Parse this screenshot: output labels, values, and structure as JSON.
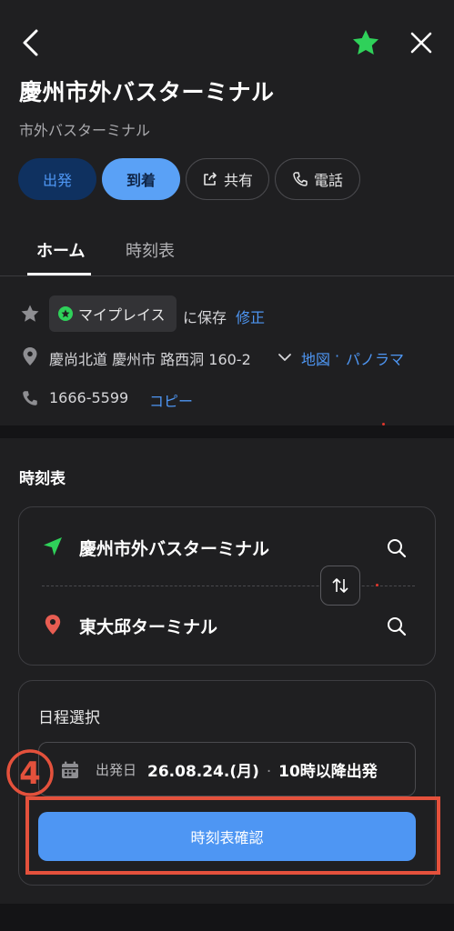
{
  "header": {
    "title": "慶州市外バスターミナル",
    "subtitle": "市外バスターミナル"
  },
  "actions": {
    "depart": "出発",
    "arrive": "到着",
    "share": "共有",
    "phone": "電話"
  },
  "tabs": {
    "home": "ホーム",
    "timetable": "時刻表"
  },
  "info": {
    "myplace_chip": "マイプレイス",
    "saved_text": "に保存",
    "edit_link": "修正",
    "address": "慶尚北道 慶州市 路西洞 160-2",
    "map_link": "地図",
    "link_separator": "·",
    "panorama_link": "パノラマ",
    "phone_number": "1666-5599",
    "copy_link": "コピー"
  },
  "timetable_section": {
    "title": "時刻表",
    "origin": "慶州市外バスターミナル",
    "destination": "東大邱ターミナル"
  },
  "schedule": {
    "title": "日程選択",
    "date_label": "出発日",
    "date_value": "26.08.24.(月)",
    "separator": "·",
    "time_value": "10時以降出発",
    "step_number": "4",
    "confirm_button": "時刻表確認"
  },
  "colors": {
    "background": "#1f1f21",
    "accent_blue": "#4e96f3",
    "favorite_green": "#2fd15a",
    "highlight_red": "#e4513c",
    "destination_pin": "#e85d52"
  },
  "icons": [
    "back-icon",
    "star-icon",
    "close-icon",
    "share-icon",
    "phone-icon",
    "location-pin-icon",
    "chevron-down-icon",
    "navigation-arrow-icon",
    "swap-icon",
    "search-icon",
    "calendar-icon"
  ]
}
